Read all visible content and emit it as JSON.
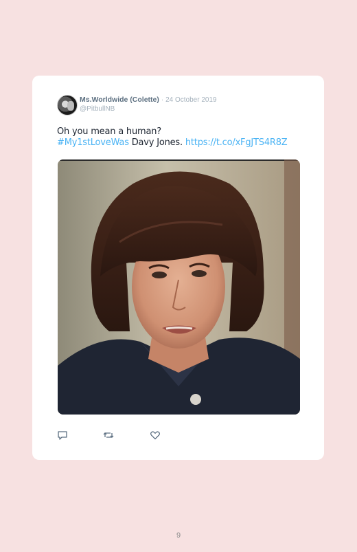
{
  "tweet": {
    "display_name": "Ms.Worldwide (Colette)",
    "separator": "·",
    "date": "24 October 2019",
    "handle": "@PitbullNB",
    "text_line1": "Oh you mean a human?",
    "hashtag": "#My1stLoveWas",
    "text_mid": " Davy Jones. ",
    "url": "https://t.co/xFgJTS4R8Z"
  },
  "actions": {
    "reply_icon": "reply-icon",
    "retweet_icon": "retweet-icon",
    "like_icon": "heart-icon"
  },
  "colors": {
    "page_background": "#f7e1e1",
    "card_background": "#ffffff",
    "link": "#4ab3f4",
    "name": "#5c6f80",
    "meta": "#a3b0bb"
  },
  "page": {
    "number": "9"
  }
}
